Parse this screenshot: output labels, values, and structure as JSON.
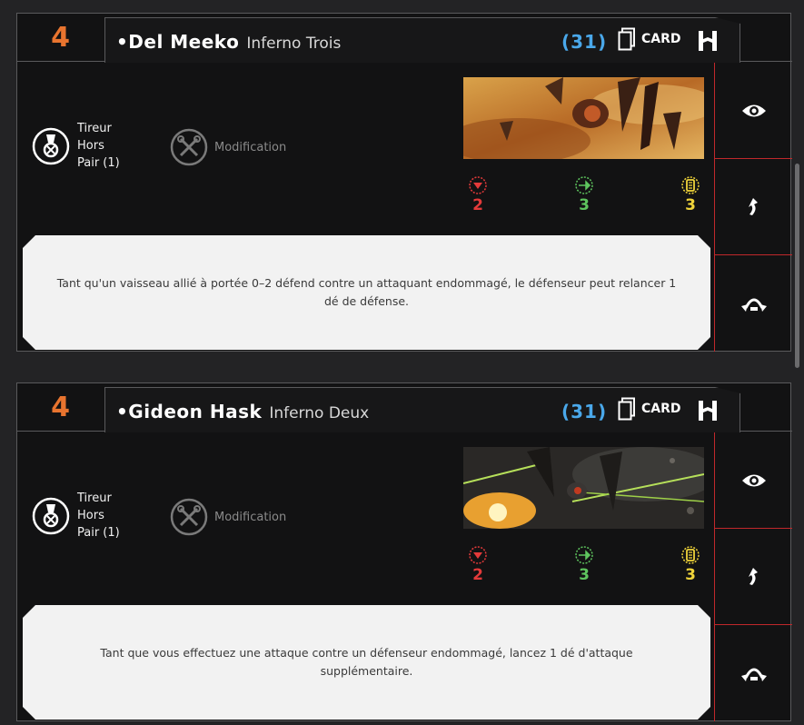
{
  "cards": [
    {
      "initiative": "4",
      "pilot_name": "•Del Meeko",
      "ship_name": "Inferno Trois",
      "cost": "(31)",
      "card_label": "CARD",
      "talent": {
        "line1": "Tireur",
        "line2": "Hors",
        "line3": "Pair (1)"
      },
      "modification_label": "Modification",
      "stats": {
        "attack": "2",
        "agility": "3",
        "hull": "3"
      },
      "ability": "Tant qu'un vaisseau allié à portée 0–2 défend contre un attaquant endommagé, le défenseur peut relancer 1 dé de défense."
    },
    {
      "initiative": "4",
      "pilot_name": "•Gideon Hask",
      "ship_name": "Inferno Deux",
      "cost": "(31)",
      "card_label": "CARD",
      "talent": {
        "line1": "Tireur",
        "line2": "Hors",
        "line3": "Pair (1)"
      },
      "modification_label": "Modification",
      "stats": {
        "attack": "2",
        "agility": "3",
        "hull": "3"
      },
      "ability": "Tant que vous effectuez une attaque contre un défenseur endommagé, lancez 1 dé d'attaque supplémentaire."
    }
  ],
  "colors": {
    "initiative": "#e8742f",
    "cost": "#4aa8ea",
    "attack": "#e33a3a",
    "agility": "#5ec45e",
    "hull": "#f0d43a",
    "divider": "#c0282b"
  },
  "icons": {
    "card": "card-icon",
    "faction": "galactic-empire-icon",
    "talent": "talent-medal-icon",
    "modification": "modification-wrench-icon",
    "sidebar": [
      "eye-icon",
      "focus-arrow-icon",
      "barrel-roll-icon"
    ]
  }
}
